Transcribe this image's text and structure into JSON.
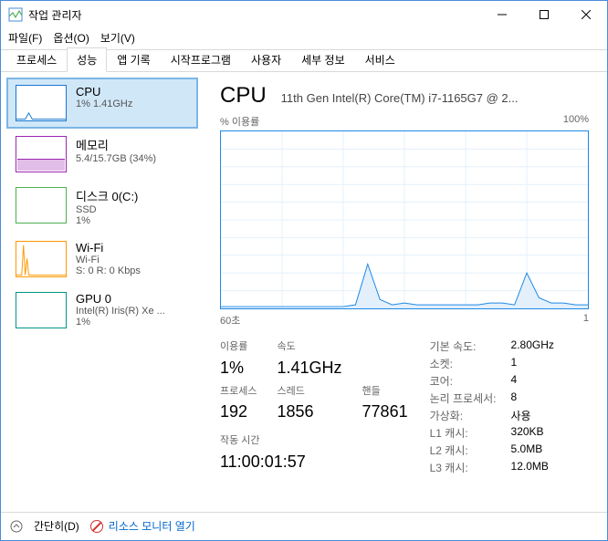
{
  "window": {
    "title": "작업 관리자"
  },
  "menu": {
    "file": "파일(F)",
    "option": "옵션(O)",
    "view": "보기(V)"
  },
  "tabs": [
    {
      "label": "프로세스"
    },
    {
      "label": "성능",
      "active": true
    },
    {
      "label": "앱 기록"
    },
    {
      "label": "시작프로그램"
    },
    {
      "label": "사용자"
    },
    {
      "label": "세부 정보"
    },
    {
      "label": "서비스"
    }
  ],
  "sidebar": {
    "items": [
      {
        "name": "CPU",
        "sub1": "1% 1.41GHz"
      },
      {
        "name": "메모리",
        "sub1": "5.4/15.7GB (34%)"
      },
      {
        "name": "디스크 0(C:)",
        "sub1": "SSD",
        "sub2": "1%"
      },
      {
        "name": "Wi-Fi",
        "sub1": "Wi-Fi",
        "sub2": "S: 0 R: 0 Kbps"
      },
      {
        "name": "GPU 0",
        "sub1": "Intel(R) Iris(R) Xe ...",
        "sub2": "1%"
      }
    ]
  },
  "main": {
    "title": "CPU",
    "model": "11th Gen Intel(R) Core(TM) i7-1165G7 @ 2...",
    "ylabel": "% 이용률",
    "ymax": "100%",
    "xleft": "60초",
    "xright": "1",
    "stats": {
      "util_lbl": "이용률",
      "util": "1%",
      "speed_lbl": "속도",
      "speed": "1.41GHz",
      "proc_lbl": "프로세스",
      "proc": "192",
      "thread_lbl": "스레드",
      "thread": "1856",
      "handle_lbl": "핸들",
      "handle": "77861",
      "uptime_lbl": "작동 시간",
      "uptime": "11:00:01:57"
    },
    "right": {
      "basespeed_k": "기본 속도:",
      "basespeed_v": "2.80GHz",
      "sockets_k": "소켓:",
      "sockets_v": "1",
      "cores_k": "코어:",
      "cores_v": "4",
      "logical_k": "논리 프로세서:",
      "logical_v": "8",
      "virt_k": "가상화:",
      "virt_v": "사용",
      "l1_k": "L1 캐시:",
      "l1_v": "320KB",
      "l2_k": "L2 캐시:",
      "l2_v": "5.0MB",
      "l3_k": "L3 캐시:",
      "l3_v": "12.0MB"
    }
  },
  "footer": {
    "brief": "간단히(D)",
    "resmon": "리소스 모니터 열기"
  },
  "chart_data": {
    "type": "line",
    "title": "CPU % 이용률",
    "xlabel": "초",
    "ylabel": "% 이용률",
    "ylim": [
      0,
      100
    ],
    "xlim": [
      60,
      1
    ],
    "x": [
      60,
      58,
      56,
      54,
      52,
      50,
      48,
      46,
      44,
      42,
      40,
      38,
      36,
      34,
      32,
      30,
      28,
      26,
      24,
      22,
      20,
      18,
      16,
      14,
      12,
      10,
      8,
      6,
      4,
      2,
      1
    ],
    "values": [
      1,
      1,
      1,
      1,
      1,
      1,
      1,
      1,
      1,
      1,
      1,
      2,
      25,
      5,
      2,
      3,
      2,
      2,
      2,
      2,
      2,
      2,
      3,
      3,
      2,
      20,
      6,
      3,
      3,
      2,
      2
    ],
    "grid": true,
    "legend": null
  }
}
